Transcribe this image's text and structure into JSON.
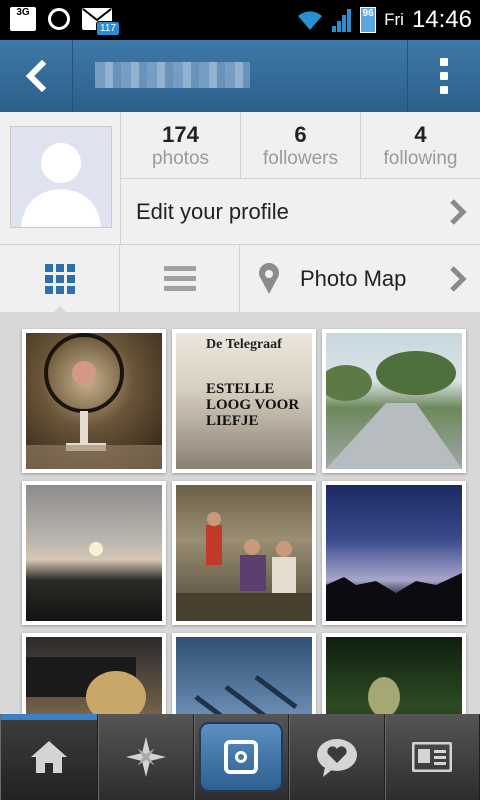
{
  "status_bar": {
    "network": "3G",
    "mail_count": "117",
    "battery": "96",
    "day": "Fri",
    "time": "14:46"
  },
  "header": {
    "back_icon": "chevron-left-icon",
    "menu_icon": "kebab-menu-icon"
  },
  "profile": {
    "stats": [
      {
        "value": "174",
        "label": "photos"
      },
      {
        "value": "6",
        "label": "followers"
      },
      {
        "value": "4",
        "label": "following"
      }
    ],
    "edit_label": "Edit your profile"
  },
  "view_tabs": {
    "grid_icon": "grid-view-icon",
    "list_icon": "list-view-icon",
    "map_label": "Photo Map"
  },
  "newspaper": {
    "masthead": "De Telegraaf",
    "line1": "ESTELLE",
    "line2": "LOOG VOOR",
    "line3": "LIEFJE"
  },
  "bottom_tabs": [
    {
      "icon": "home-icon"
    },
    {
      "icon": "explore-star-icon"
    },
    {
      "icon": "camera-icon"
    },
    {
      "icon": "heart-speech-icon"
    },
    {
      "icon": "profile-card-icon"
    }
  ],
  "colors": {
    "header_blue": "#2c5f8a",
    "accent_blue": "#3b7fc4"
  }
}
